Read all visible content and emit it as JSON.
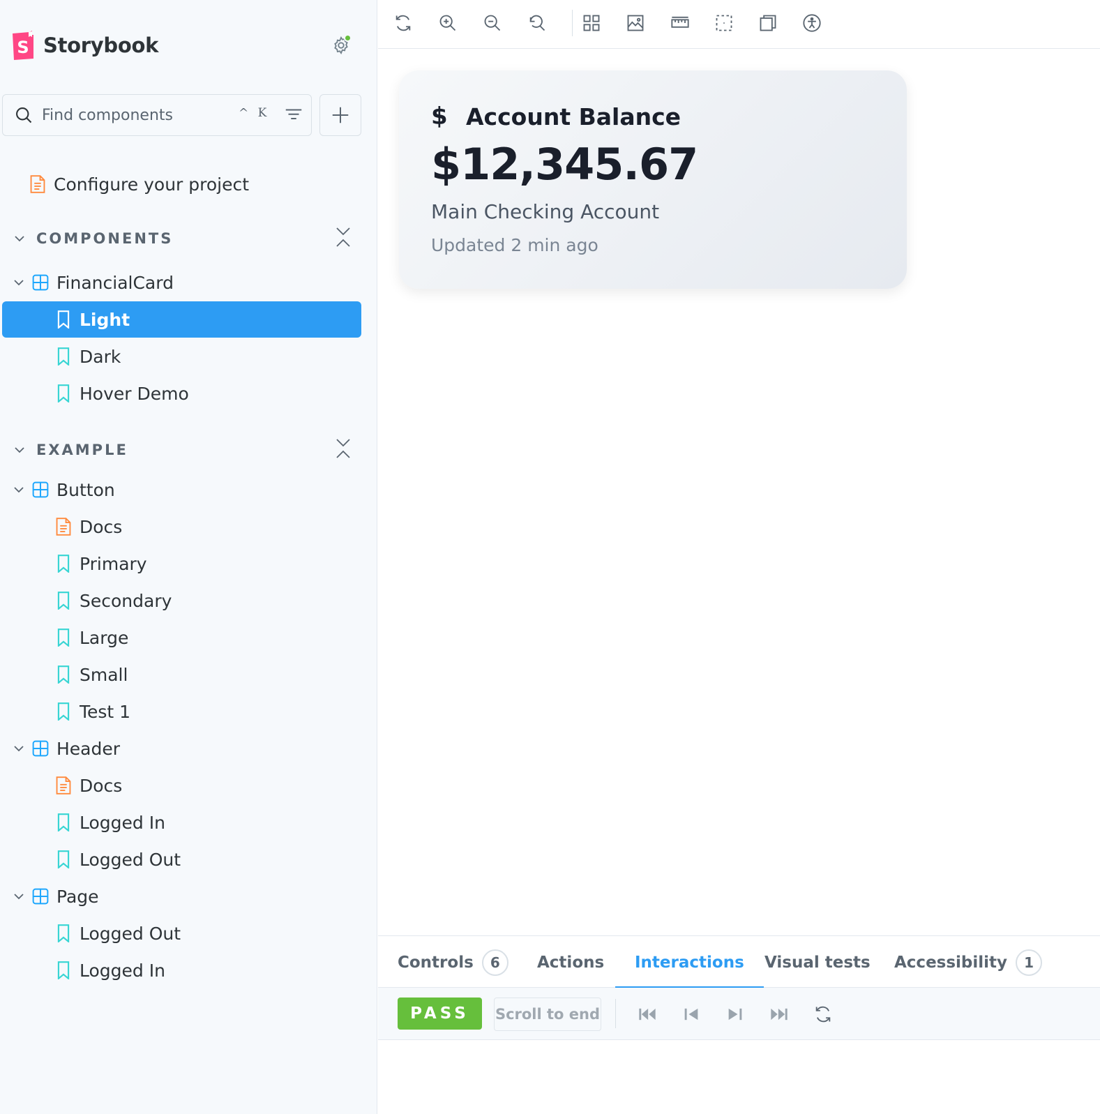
{
  "sidebar": {
    "brand": "Storybook",
    "search": {
      "placeholder": "Find components",
      "shortcut": "^ K"
    },
    "configure": "Configure your project",
    "sections": [
      {
        "title": "COMPONENTS",
        "components": [
          {
            "label": "FinancialCard",
            "stories": [
              "Light",
              "Dark",
              "Hover Demo"
            ]
          }
        ]
      },
      {
        "title": "EXAMPLE",
        "components": [
          {
            "label": "Button",
            "stories": [
              "Docs",
              "Primary",
              "Secondary",
              "Large",
              "Small",
              "Test 1"
            ]
          },
          {
            "label": "Header",
            "stories": [
              "Docs",
              "Logged In",
              "Logged Out"
            ]
          },
          {
            "label": "Page",
            "stories": [
              "Logged Out",
              "Logged In"
            ]
          }
        ]
      }
    ],
    "selected_story": "Light"
  },
  "toolbar": {
    "icons": [
      "sync-icon",
      "zoom-in-icon",
      "zoom-out-icon",
      "zoom-reset-icon",
      "grid-icon",
      "image-icon",
      "ruler-icon",
      "outline-icon",
      "window-icon",
      "accessibility-icon"
    ]
  },
  "card": {
    "icon": "$",
    "title": "Account Balance",
    "amount": "$12,345.67",
    "subtitle": "Main Checking Account",
    "updated": "Updated 2 min ago"
  },
  "panel": {
    "tabs": [
      {
        "label": "Controls",
        "badge": "6"
      },
      {
        "label": "Actions"
      },
      {
        "label": "Interactions",
        "active": true
      },
      {
        "label": "Visual tests"
      },
      {
        "label": "Accessibility",
        "badge": "1"
      }
    ],
    "status": "PASS",
    "scroll_to_end": "Scroll to end"
  },
  "colors": {
    "accent": "#2d9cf3",
    "pass": "#66bf3c",
    "story_icon": "#37d5d3",
    "docs_icon": "#ff8a3d",
    "component_icon": "#1ea7fd",
    "brand": "#ff4785"
  }
}
